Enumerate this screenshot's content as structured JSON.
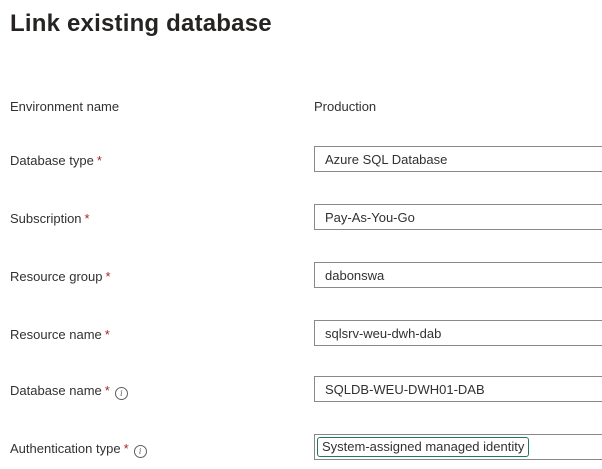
{
  "page": {
    "title": "Link existing database"
  },
  "form": {
    "environment": {
      "label": "Environment name",
      "value": "Production"
    },
    "database_type": {
      "label": "Database type",
      "required_mark": "*",
      "value": "Azure SQL Database"
    },
    "subscription": {
      "label": "Subscription",
      "required_mark": "*",
      "value": "Pay-As-You-Go"
    },
    "resource_group": {
      "label": "Resource group",
      "required_mark": "*",
      "value": "dabonswa"
    },
    "resource_name": {
      "label": "Resource name",
      "required_mark": "*",
      "value": "sqlsrv-weu-dwh-dab"
    },
    "database_name": {
      "label": "Database name",
      "required_mark": "*",
      "info_icon": "info-icon",
      "value": "SQLDB-WEU-DWH01-DAB"
    },
    "authentication_type": {
      "label": "Authentication type",
      "required_mark": "*",
      "info_icon": "info-icon",
      "value": "System-assigned managed identity"
    }
  },
  "colors": {
    "required": "#a4262c",
    "focus_outline": "#1f7a57",
    "field_border": "#8a8886"
  }
}
